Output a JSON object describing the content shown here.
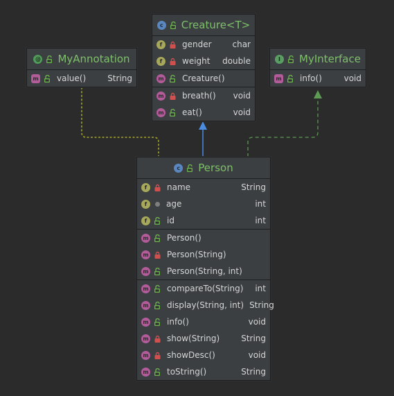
{
  "colors": {
    "background": "#2b2b2b",
    "class_title": "#7ec06a",
    "field_icon": "#a7a85a",
    "method_icon": "#b35c9a",
    "class_icon": "#5a87c0",
    "interface_icon": "#5a9e63",
    "inheritance_arrow": "#4a8de0",
    "implementation_arrow": "#5f9a55",
    "annotation_link": "#9a9a2a"
  },
  "creature": {
    "title": "Creature<T>",
    "fields": [
      {
        "name": "gender",
        "type": "char",
        "access": "private"
      },
      {
        "name": "weight",
        "type": "double",
        "access": "private"
      }
    ],
    "constructors": [
      {
        "name": "Creature()",
        "type": "",
        "access": "public"
      }
    ],
    "methods": [
      {
        "name": "breath()",
        "type": "void",
        "access": "private"
      },
      {
        "name": "eat()",
        "type": "void",
        "access": "public"
      }
    ]
  },
  "annotation": {
    "title": "MyAnnotation",
    "methods": [
      {
        "name": "value()",
        "type": "String",
        "access": "public"
      }
    ]
  },
  "interface": {
    "title": "MyInterface",
    "methods": [
      {
        "name": "info()",
        "type": "void",
        "access": "public"
      }
    ]
  },
  "person": {
    "title": "Person",
    "fields": [
      {
        "name": "name",
        "type": "String",
        "access": "private"
      },
      {
        "name": "age",
        "type": "int",
        "access": "package"
      },
      {
        "name": "id",
        "type": "int",
        "access": "public"
      }
    ],
    "constructors": [
      {
        "name": "Person()",
        "type": "",
        "access": "public"
      },
      {
        "name": "Person(String)",
        "type": "",
        "access": "private"
      },
      {
        "name": "Person(String, int)",
        "type": "",
        "access": "public"
      }
    ],
    "methods": [
      {
        "name": "compareTo(String)",
        "type": "int",
        "access": "public"
      },
      {
        "name": "display(String, int)",
        "type": "String",
        "access": "public"
      },
      {
        "name": "info()",
        "type": "void",
        "access": "public"
      },
      {
        "name": "show(String)",
        "type": "String",
        "access": "private"
      },
      {
        "name": "showDesc()",
        "type": "void",
        "access": "private"
      },
      {
        "name": "toString()",
        "type": "String",
        "access": "public"
      }
    ]
  }
}
